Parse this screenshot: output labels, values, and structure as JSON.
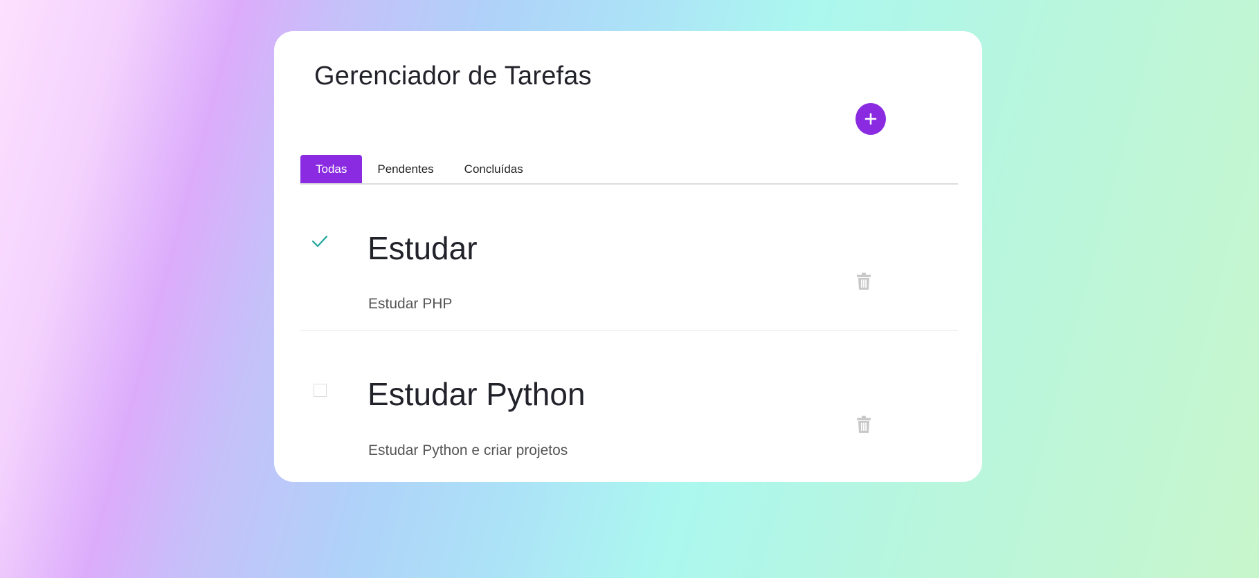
{
  "app": {
    "title": "Gerenciador de Tarefas",
    "accent_color": "#8a2be2",
    "check_color": "#1aa59a"
  },
  "toolbar": {
    "add_icon": "plus-icon"
  },
  "tabs": [
    {
      "label": "Todas",
      "active": true
    },
    {
      "label": "Pendentes",
      "active": false
    },
    {
      "label": "Concluídas",
      "active": false
    }
  ],
  "tasks": [
    {
      "title": "Estudar",
      "description": "Estudar PHP",
      "completed": true,
      "status_icon": "check-icon",
      "delete_icon": "trash-icon"
    },
    {
      "title": "Estudar Python",
      "description": "Estudar Python e criar projetos",
      "completed": false,
      "status_icon": "checkbox-icon",
      "delete_icon": "trash-icon"
    }
  ]
}
